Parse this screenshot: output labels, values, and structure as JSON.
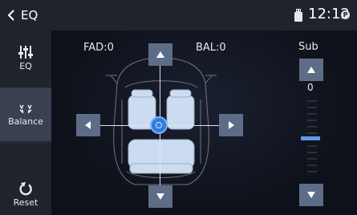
{
  "titlebar": {
    "back_label": "EQ",
    "time": "12:12",
    "badge": "P"
  },
  "sidebar": {
    "items": [
      {
        "label": "EQ",
        "icon": "equalizer-sliders-icon"
      },
      {
        "label": "Balance",
        "icon": "speaker-balance-icon",
        "active": true
      },
      {
        "label": "Reset",
        "icon": "reset-arrow-icon"
      }
    ]
  },
  "balance": {
    "fad_text": "FAD:0",
    "bal_text": "BAL:0"
  },
  "subwoofer": {
    "label": "Sub",
    "value_text": "0",
    "level": 0
  },
  "colors": {
    "accent": "#2f7de0",
    "button": "#5d6d88",
    "sidebar_active": "#394052",
    "background": "#0d1018",
    "slider_thumb": "#5b9be6"
  }
}
